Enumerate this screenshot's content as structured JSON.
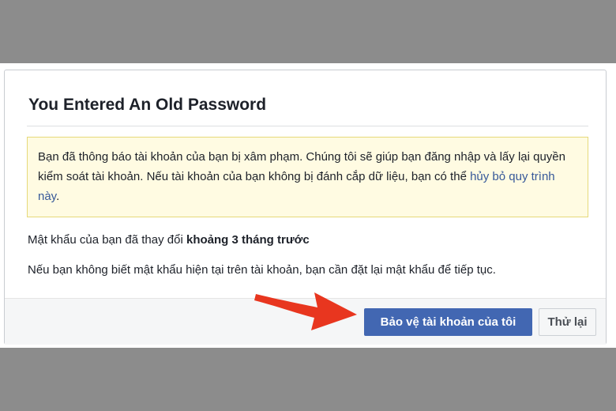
{
  "dialog": {
    "title": "You Entered An Old Password",
    "notice": {
      "text": "Bạn đã thông báo tài khoản của bạn bị xâm phạm. Chúng tôi sẽ giúp bạn đăng nhập và lấy lại quyền kiểm soát tài khoản. Nếu tài khoản của bạn không bị đánh cắp dữ liệu, bạn có thể ",
      "link": "hủy bỏ quy trình này",
      "end": "."
    },
    "changed": {
      "prefix": "Mật khẩu của bạn đã thay đổi ",
      "time": "khoảng 3 tháng trước"
    },
    "reset_note": "Nếu bạn không biết mật khẩu hiện tại trên tài khoản, bạn cần đặt lại mật khẩu để tiếp tục.",
    "buttons": {
      "protect": "Bảo vệ tài khoản của tôi",
      "retry": "Thử lại"
    }
  },
  "annotation": {
    "icon": "red-arrow-icon",
    "color": "#e8361f"
  },
  "colors": {
    "primary": "#4267b2",
    "notice_bg": "#fffbe2",
    "notice_border": "#e6d97a",
    "link": "#365899"
  }
}
